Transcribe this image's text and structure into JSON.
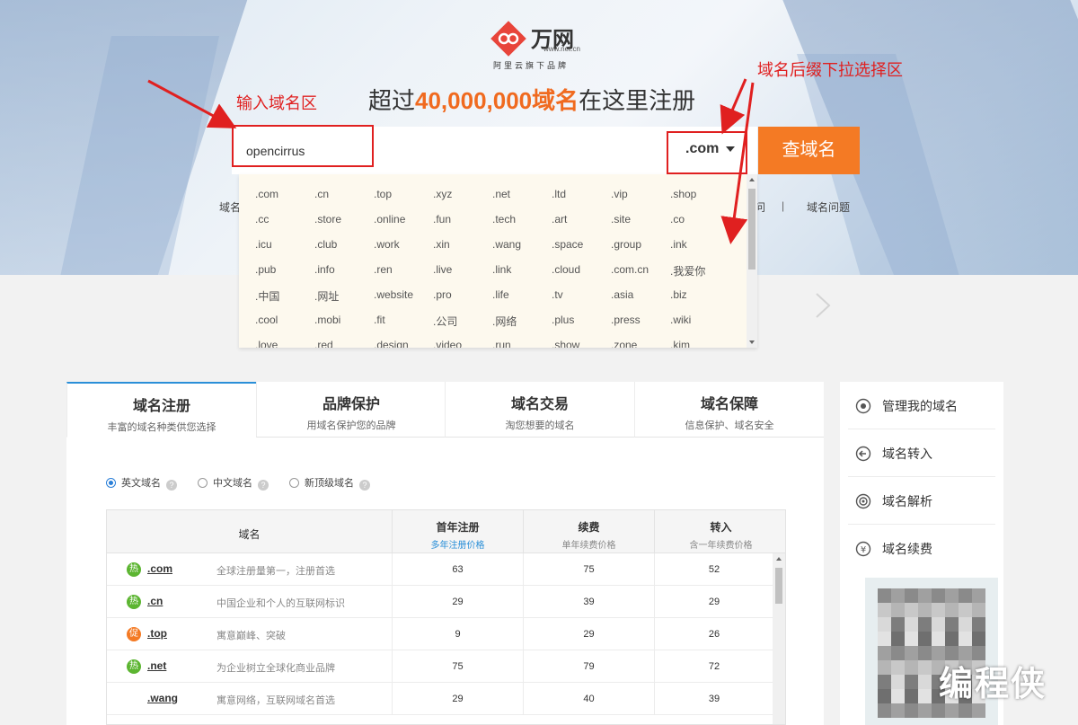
{
  "brand": {
    "name": "万网",
    "domain": "www.net.cn",
    "tagline": "阿里云旗下品牌",
    "accent": "#f47a24",
    "logo_color": "#e8443a"
  },
  "headline": {
    "prefix": "超过",
    "highlight": "40,000,000域名",
    "suffix": "在这里注册"
  },
  "search": {
    "value": "opencirrus",
    "suffix_selected": ".com",
    "button_label": "查域名"
  },
  "annotations": {
    "input_label": "输入域名区",
    "suffix_label": "域名后缀下拉选择区",
    "color": "#e02020"
  },
  "hero_links": {
    "left": "域名",
    "right_partial": "问",
    "sep": "|",
    "faq": "域名问题"
  },
  "suffix_options": [
    [
      ".com",
      ".cn",
      ".top",
      ".xyz",
      ".net",
      ".ltd",
      ".vip",
      ".shop"
    ],
    [
      ".cc",
      ".store",
      ".online",
      ".fun",
      ".tech",
      ".art",
      ".site",
      ".co"
    ],
    [
      ".icu",
      ".club",
      ".work",
      ".xin",
      ".wang",
      ".space",
      ".group",
      ".ink"
    ],
    [
      ".pub",
      ".info",
      ".ren",
      ".live",
      ".link",
      ".cloud",
      ".com.cn",
      ".我爱你"
    ],
    [
      ".中国",
      ".网址",
      ".website",
      ".pro",
      ".life",
      ".tv",
      ".asia",
      ".biz"
    ],
    [
      ".cool",
      ".mobi",
      ".fit",
      ".公司",
      ".网络",
      ".plus",
      ".press",
      ".wiki"
    ],
    [
      ".love",
      ".red",
      ".design",
      ".video",
      ".run",
      ".show",
      ".zone",
      ".kim"
    ]
  ],
  "tabs": [
    {
      "title": "域名注册",
      "sub": "丰富的域名种类供您选择"
    },
    {
      "title": "品牌保护",
      "sub": "用域名保护您的品牌"
    },
    {
      "title": "域名交易",
      "sub": "淘您想要的域名"
    },
    {
      "title": "域名保障",
      "sub": "信息保护、域名安全"
    }
  ],
  "filters": [
    {
      "label": "英文域名",
      "checked": true
    },
    {
      "label": "中文域名",
      "checked": false
    },
    {
      "label": "新顶级域名",
      "checked": false
    }
  ],
  "table": {
    "headers": {
      "domain": "域名",
      "first_year": {
        "title": "首年注册",
        "sub": "多年注册价格"
      },
      "renew": {
        "title": "续费",
        "sub": "单年续费价格"
      },
      "transfer": {
        "title": "转入",
        "sub": "含一年续费价格"
      }
    },
    "rows": [
      {
        "badge": "热",
        "badge_type": "hot",
        "name": ".com",
        "desc": "全球注册量第一，注册首选",
        "first_year": "63",
        "renew": "75",
        "transfer": "52"
      },
      {
        "badge": "热",
        "badge_type": "hot",
        "name": ".cn",
        "desc": "中国企业和个人的互联网标识",
        "first_year": "29",
        "renew": "39",
        "transfer": "29"
      },
      {
        "badge": "促",
        "badge_type": "promo",
        "name": ".top",
        "desc": "寓意巅峰、突破",
        "first_year": "9",
        "renew": "29",
        "transfer": "26"
      },
      {
        "badge": "热",
        "badge_type": "hot",
        "name": ".net",
        "desc": "为企业树立全球化商业品牌",
        "first_year": "75",
        "renew": "79",
        "transfer": "72"
      },
      {
        "badge": "",
        "badge_type": "none",
        "name": ".wang",
        "desc": "寓意网络，互联网域名首选",
        "first_year": "29",
        "renew": "40",
        "transfer": "39"
      }
    ]
  },
  "side_menu": [
    {
      "label": "管理我的域名",
      "icon": "gear-icon"
    },
    {
      "label": "域名转入",
      "icon": "back-arrow-icon"
    },
    {
      "label": "域名解析",
      "icon": "target-icon"
    },
    {
      "label": "域名续费",
      "icon": "yen-icon"
    }
  ],
  "watermark": "编程侠"
}
